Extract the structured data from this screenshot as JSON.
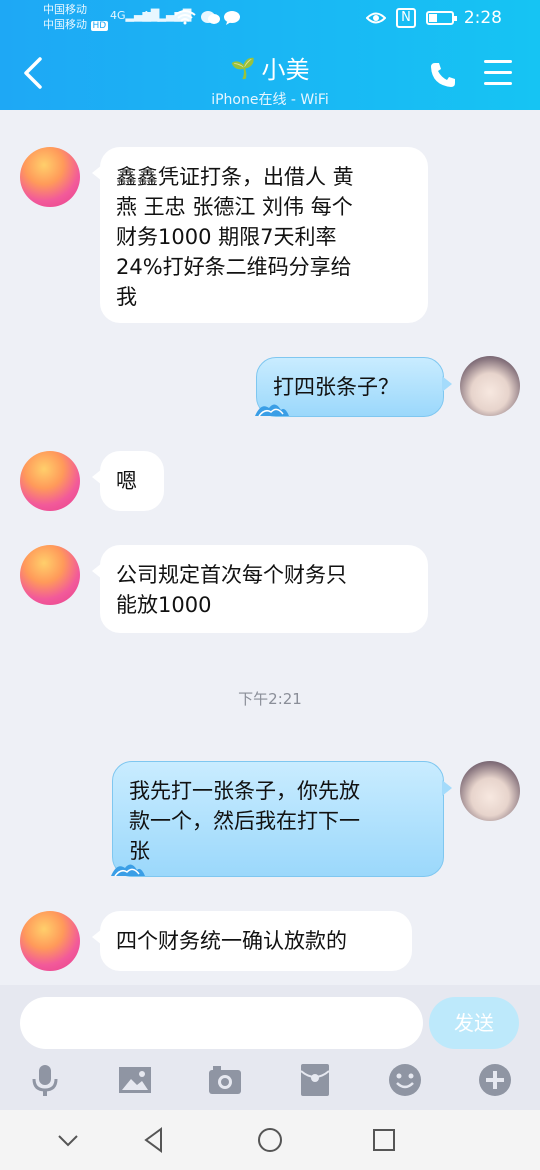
{
  "status_bar": {
    "carrier1": "中国移动",
    "carrier2": "中国移动",
    "hd": "HD",
    "sig1": "4G",
    "sig2": "4G",
    "nfc": "N",
    "time": "2:28"
  },
  "header": {
    "title": "小美",
    "subtitle": "iPhone在线 - WiFi",
    "bg_colors": [
      "#1ea8f5",
      "#16c4f3"
    ]
  },
  "messages": [
    {
      "side": "left",
      "lines": [
        "鑫鑫凭证打条，出借人 黄",
        "燕 王忠 张德江 刘伟 每个",
        "财务1000  期限7天利率",
        "24%打好条二维码分享给",
        "我"
      ]
    },
    {
      "side": "right",
      "lines": [
        "打四张条子？"
      ]
    },
    {
      "side": "left",
      "lines": [
        "嗯"
      ]
    },
    {
      "side": "left",
      "lines": [
        "公司规定首次每个财务只",
        "能放1000"
      ]
    },
    {
      "side": "right",
      "lines": [
        "我先打一张条子，你先放",
        "款一个，然后我在打下一",
        "张"
      ]
    },
    {
      "side": "left",
      "lines": [
        "四个财务统一确认放款的"
      ]
    }
  ],
  "timestamp": "下午2:21",
  "input": {
    "value": "",
    "send_label": "发送"
  },
  "toolbar_icons": [
    "microphone-icon",
    "image-icon",
    "camera-icon",
    "red-packet-icon",
    "emoji-icon",
    "plus-icon"
  ],
  "nav_icons": [
    "chevron-down-icon",
    "back-triangle-icon",
    "home-circle-icon",
    "recents-square-icon"
  ]
}
